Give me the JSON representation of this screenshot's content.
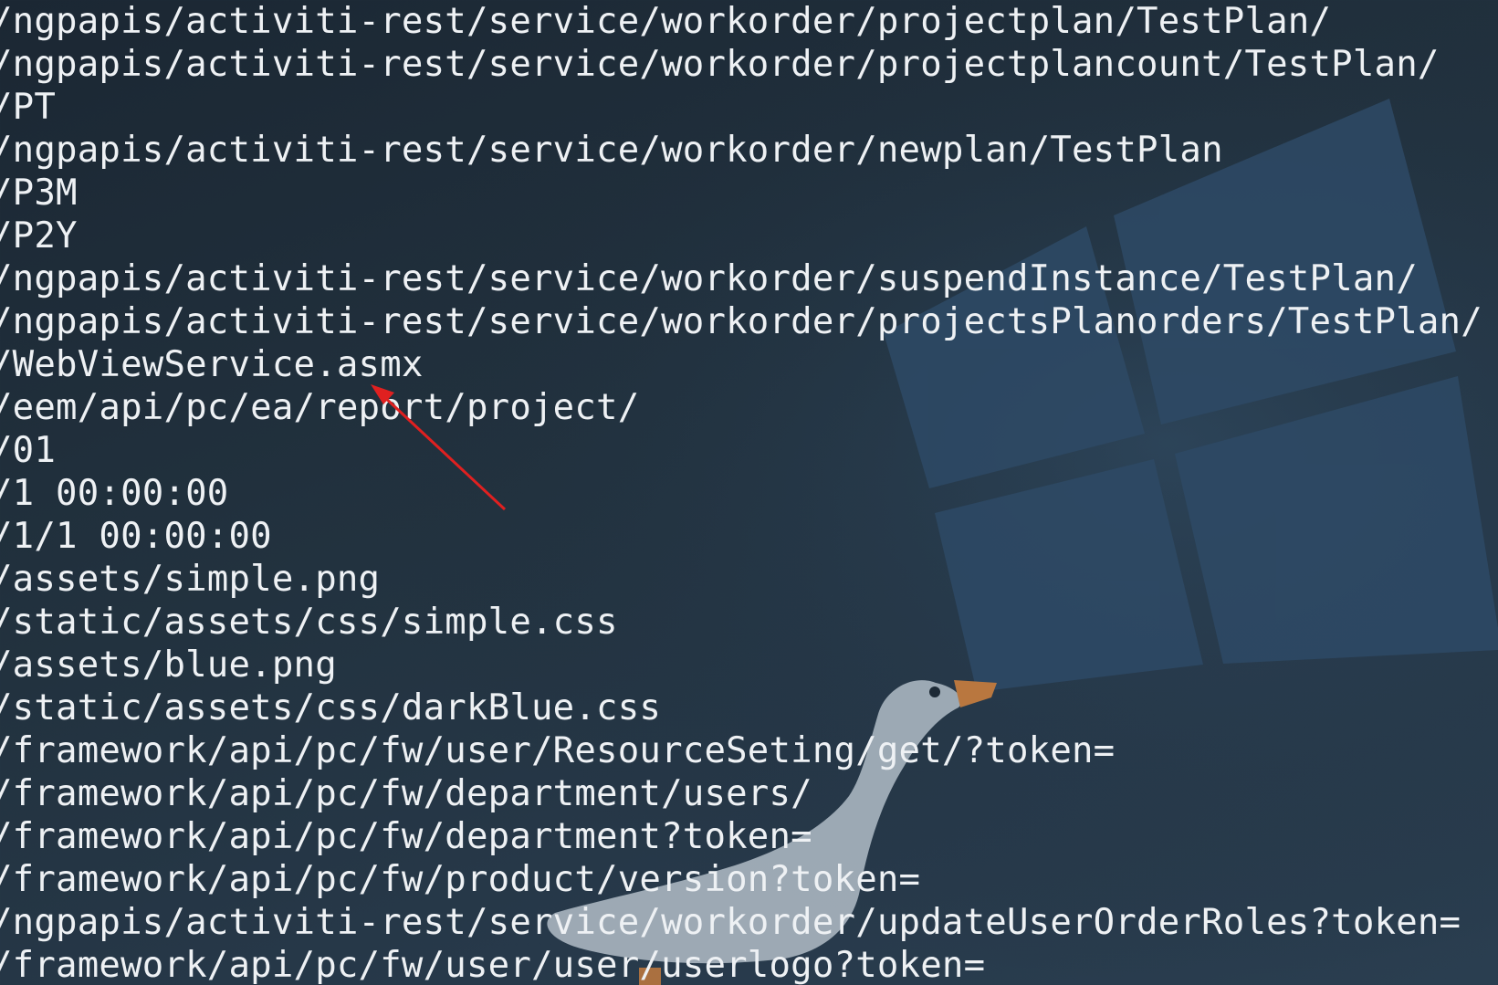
{
  "terminal": {
    "lines": [
      "/ngpapis/activiti-rest/service/workorder/projectplan/TestPlan/",
      "/ngpapis/activiti-rest/service/workorder/projectplancount/TestPlan/",
      "/PT",
      "/ngpapis/activiti-rest/service/workorder/newplan/TestPlan",
      "/P3M",
      "/P2Y",
      "/ngpapis/activiti-rest/service/workorder/suspendInstance/TestPlan/",
      "/ngpapis/activiti-rest/service/workorder/projectsPlanorders/TestPlan/",
      "/WebViewService.asmx",
      "/eem/api/pc/ea/report/project/",
      "/01",
      "/1 00:00:00",
      "/1/1 00:00:00",
      "/assets/simple.png",
      "/static/assets/css/simple.css",
      "/assets/blue.png",
      "/static/assets/css/darkBlue.css",
      "/framework/api/pc/fw/user/ResourceSeting/get/?token=",
      "/framework/api/pc/fw/department/users/",
      "/framework/api/pc/fw/department?token=",
      "/framework/api/pc/fw/product/version?token=",
      "/ngpapis/activiti-rest/service/workorder/updateUserOrderRoles?token=",
      "/framework/api/pc/fw/user/user/userlogo?token="
    ]
  },
  "colors": {
    "background": "#22323f",
    "text": "#eef1f4",
    "windows_logo": "#2e4a66",
    "goose": "#b7c2cc",
    "arrow": "#e02020"
  },
  "icons": {
    "wallpaper_logo": "windows-logo-icon",
    "wallpaper_mascot": "goose-icon",
    "annotation": "red-arrow-icon"
  }
}
